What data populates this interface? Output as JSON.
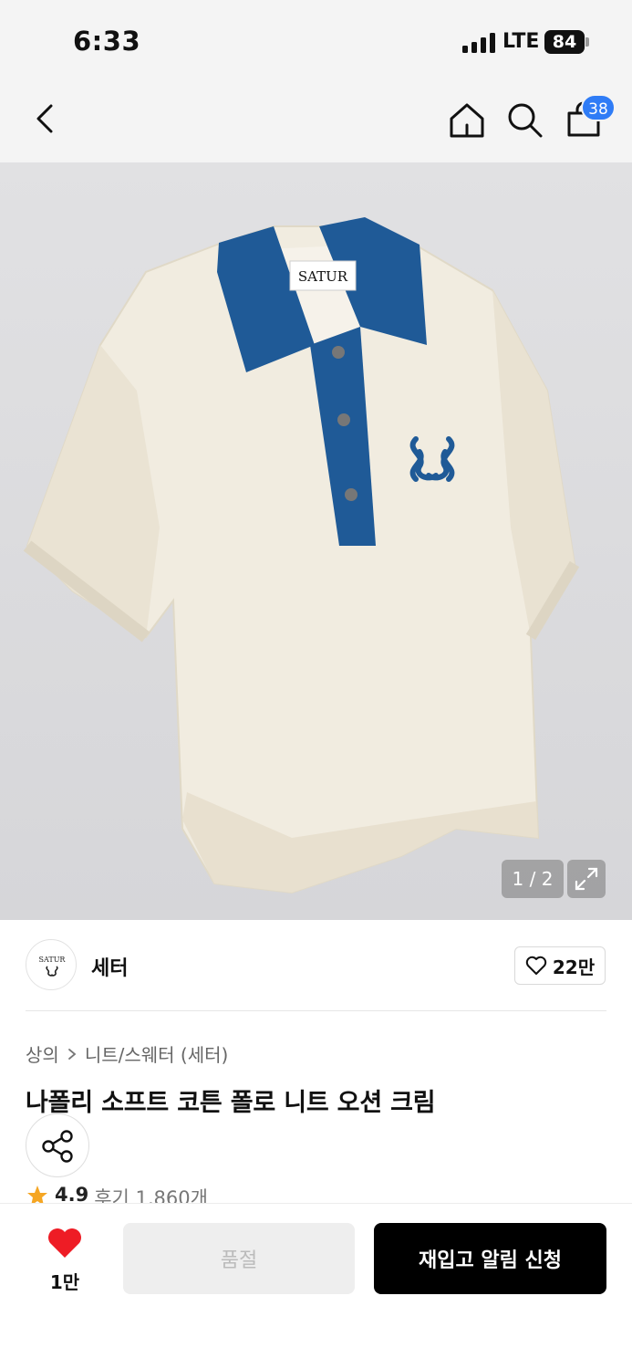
{
  "status_bar": {
    "time": "6:33",
    "network": "LTE",
    "battery": "84"
  },
  "nav": {
    "back_icon": "chevron-left-icon",
    "home_icon": "home-icon",
    "search_icon": "search-icon",
    "cart_icon": "shopping-bag-icon",
    "cart_count": "38"
  },
  "gallery": {
    "page_indicator": "1 / 2",
    "expand_icon": "expand-icon",
    "label_text": "SATUR"
  },
  "brand": {
    "logo_text": "SATUR",
    "name": "세터",
    "like_count": "22만"
  },
  "breadcrumb": {
    "category": "상의",
    "subcategory": "니트/스웨터 (세터)"
  },
  "product": {
    "title": "나폴리 소프트 코튼 폴로 니트 오션 크림",
    "rating": "4.9",
    "reviews": "후기 1,860개"
  },
  "bottom_bar": {
    "wish_count": "1만",
    "soldout_label": "품절",
    "restock_label": "재입고 알림 신청"
  },
  "colors": {
    "accent_blue": "#2f7cf6",
    "heart_red": "#ee1c25",
    "star_orange": "#f5a623",
    "collar_blue": "#1f5a97",
    "knit_cream": "#f2ede1"
  }
}
